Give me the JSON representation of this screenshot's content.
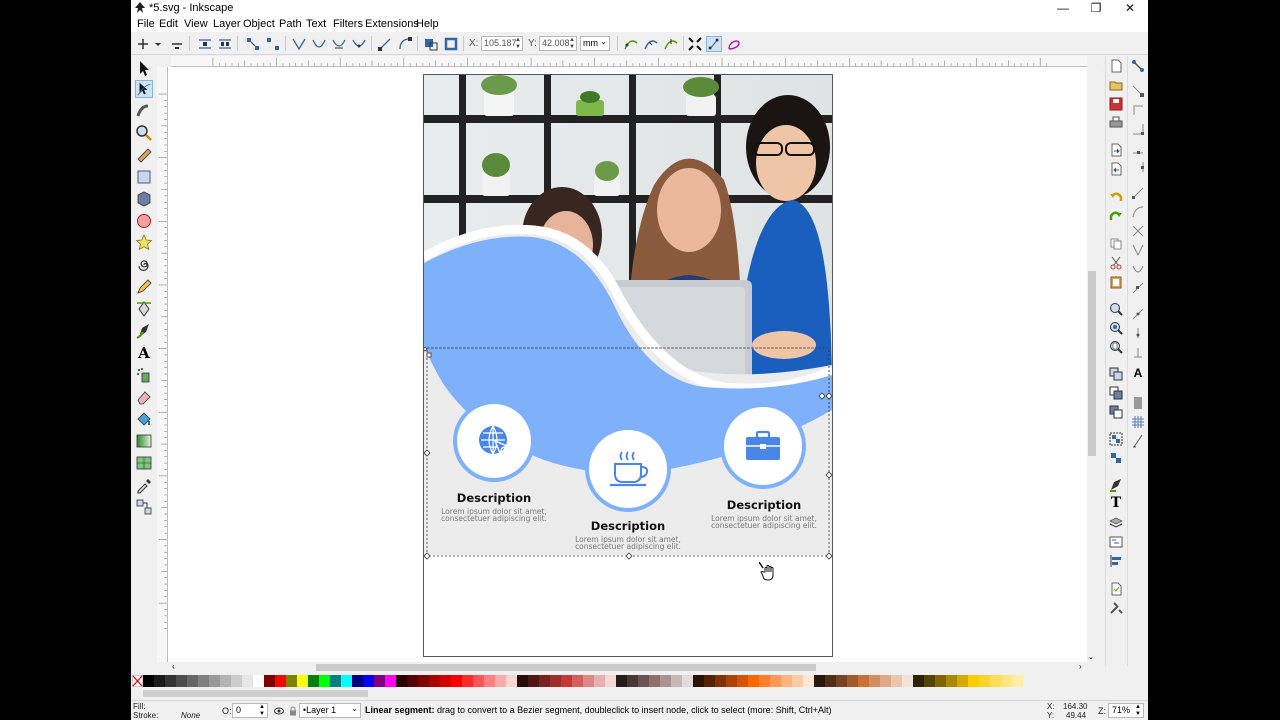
{
  "window": {
    "title": "*5.svg - Inkscape",
    "minimize": "—",
    "maximize": "❐",
    "close": "✕"
  },
  "menu": {
    "items": [
      "File",
      "Edit",
      "View",
      "Layer",
      "Object",
      "Path",
      "Text",
      "Filters",
      "Extensions",
      "Help"
    ]
  },
  "controls": {
    "x_label": "X:",
    "x_value": "105.187",
    "y_label": "Y:",
    "y_value": "42.008",
    "unit": "mm"
  },
  "document": {
    "items": [
      {
        "heading": "Description",
        "line1": "Lorem ipsum dolor sit amet,",
        "line2": "consectetuer adipiscing elit.",
        "icon": "globe-cursor-icon"
      },
      {
        "heading": "Description",
        "line1": "Lorem ipsum dolor sit amet,",
        "line2": "consectetuer adipiscing elit.",
        "icon": "coffee-cup-icon"
      },
      {
        "heading": "Description",
        "line1": "Lorem ipsum dolor sit amet,",
        "line2": "consectetuer adipiscing elit.",
        "icon": "briefcase-icon"
      }
    ],
    "wave_color": "#7fb1fb",
    "icon_color": "#4a86e8"
  },
  "status": {
    "fill_label": "Fill:",
    "stroke_label": "Stroke:",
    "stroke_value": "None",
    "opacity_label": "O:",
    "opacity_value": "0",
    "layer": "•Layer 1",
    "message_bold": "Linear segment:",
    "message": " drag to convert to a Bezier segment, doubleclick to insert node, click to select (more: Shift, Ctrl+Alt)",
    "x_coord_label": "X:",
    "x_coord": "164.30",
    "y_coord_label": "Y:",
    "y_coord": "49.44",
    "zoom_label": "Z:",
    "zoom": "71%"
  },
  "palette": [
    "#000000",
    "#1a1a1a",
    "#333333",
    "#4d4d4d",
    "#666666",
    "#808080",
    "#999999",
    "#b3b3b3",
    "#cccccc",
    "#e6e6e6",
    "#ffffff",
    "#800000",
    "#ff0000",
    "#808000",
    "#ffff00",
    "#008000",
    "#00ff00",
    "#008080",
    "#00ffff",
    "#000080",
    "#0000ff",
    "#800080",
    "#ff00ff",
    "#2b0000",
    "#550000",
    "#800000",
    "#aa0000",
    "#d40000",
    "#ff0000",
    "#ff2a2a",
    "#ff5555",
    "#ff8080",
    "#ffaaaa",
    "#ffd5d5",
    "#280b0b",
    "#501616",
    "#782121",
    "#a02c2c",
    "#c83737",
    "#d35f5f",
    "#de8787",
    "#e9afaf",
    "#f4d7d7",
    "#241c1c",
    "#483737",
    "#6c5353",
    "#916f6f",
    "#ac9393",
    "#c8b7b7",
    "#e3dbdb",
    "#2b1100",
    "#552200",
    "#803300",
    "#aa4400",
    "#d45500",
    "#ff6600",
    "#ff7f2a",
    "#ff9955",
    "#ffb380",
    "#ffccaa",
    "#ffe6d5",
    "#28170b",
    "#502d16",
    "#784421",
    "#a05a2c",
    "#c87137",
    "#d38d5f",
    "#deaa87",
    "#e9c6af",
    "#f4e3d7",
    "#2b2200",
    "#554400",
    "#806600",
    "#aa8800",
    "#d4aa00",
    "#ffcc00",
    "#ffd42a",
    "#ffdd55",
    "#ffe680",
    "#ffeeaa"
  ]
}
